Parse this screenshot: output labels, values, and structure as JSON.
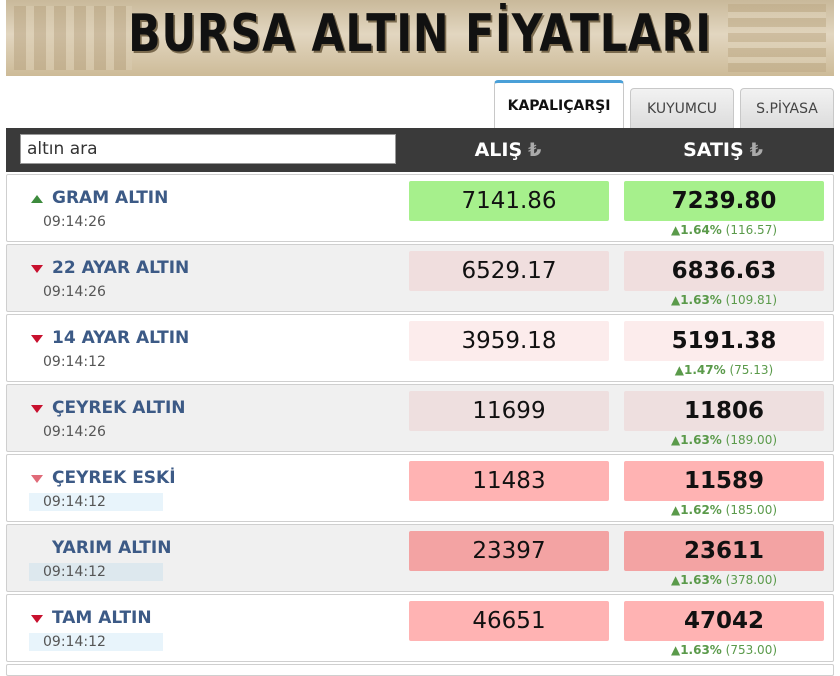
{
  "banner": {
    "title": "BURSA ALTIN FİYATLARI"
  },
  "tabs": [
    {
      "label": "KAPALIÇARŞI",
      "active": true
    },
    {
      "label": "KUYUMCU",
      "active": false
    },
    {
      "label": "S.PİYASA",
      "active": false
    }
  ],
  "search": {
    "placeholder": "altın ara"
  },
  "columns": {
    "buy": "ALIŞ",
    "sell": "SATIŞ",
    "currency_symbol": "₺"
  },
  "colors": {
    "header_bg": "#3a3a3a",
    "name": "#3c5a86",
    "up": "#3d8b3d",
    "down": "#c8102e",
    "change": "#5a9a4a"
  },
  "rows": [
    {
      "name": "GRAM ALTIN",
      "time": "09:14:26",
      "buy": "7141.86",
      "sell": "7239.80",
      "change_pct": "▲1.64%",
      "change_abs": "(116.57)",
      "trend": "up"
    },
    {
      "name": "22 AYAR ALTIN",
      "time": "09:14:26",
      "buy": "6529.17",
      "sell": "6836.63",
      "change_pct": "▲1.63%",
      "change_abs": "(109.81)",
      "trend": "down"
    },
    {
      "name": "14 AYAR ALTIN",
      "time": "09:14:12",
      "buy": "3959.18",
      "sell": "5191.38",
      "change_pct": "▲1.47%",
      "change_abs": "(75.13)",
      "trend": "down"
    },
    {
      "name": "ÇEYREK ALTIN",
      "time": "09:14:26",
      "buy": "11699",
      "sell": "11806",
      "change_pct": "▲1.63%",
      "change_abs": "(189.00)",
      "trend": "down"
    },
    {
      "name": "ÇEYREK ESKİ",
      "time": "09:14:12",
      "buy": "11483",
      "sell": "11589",
      "change_pct": "▲1.62%",
      "change_abs": "(185.00)",
      "trend": "down"
    },
    {
      "name": "YARIM ALTIN",
      "time": "09:14:12",
      "buy": "23397",
      "sell": "23611",
      "change_pct": "▲1.63%",
      "change_abs": "(378.00)",
      "trend": "none"
    },
    {
      "name": "TAM ALTIN",
      "time": "09:14:12",
      "buy": "46651",
      "sell": "47042",
      "change_pct": "▲1.63%",
      "change_abs": "(753.00)",
      "trend": "down"
    }
  ]
}
